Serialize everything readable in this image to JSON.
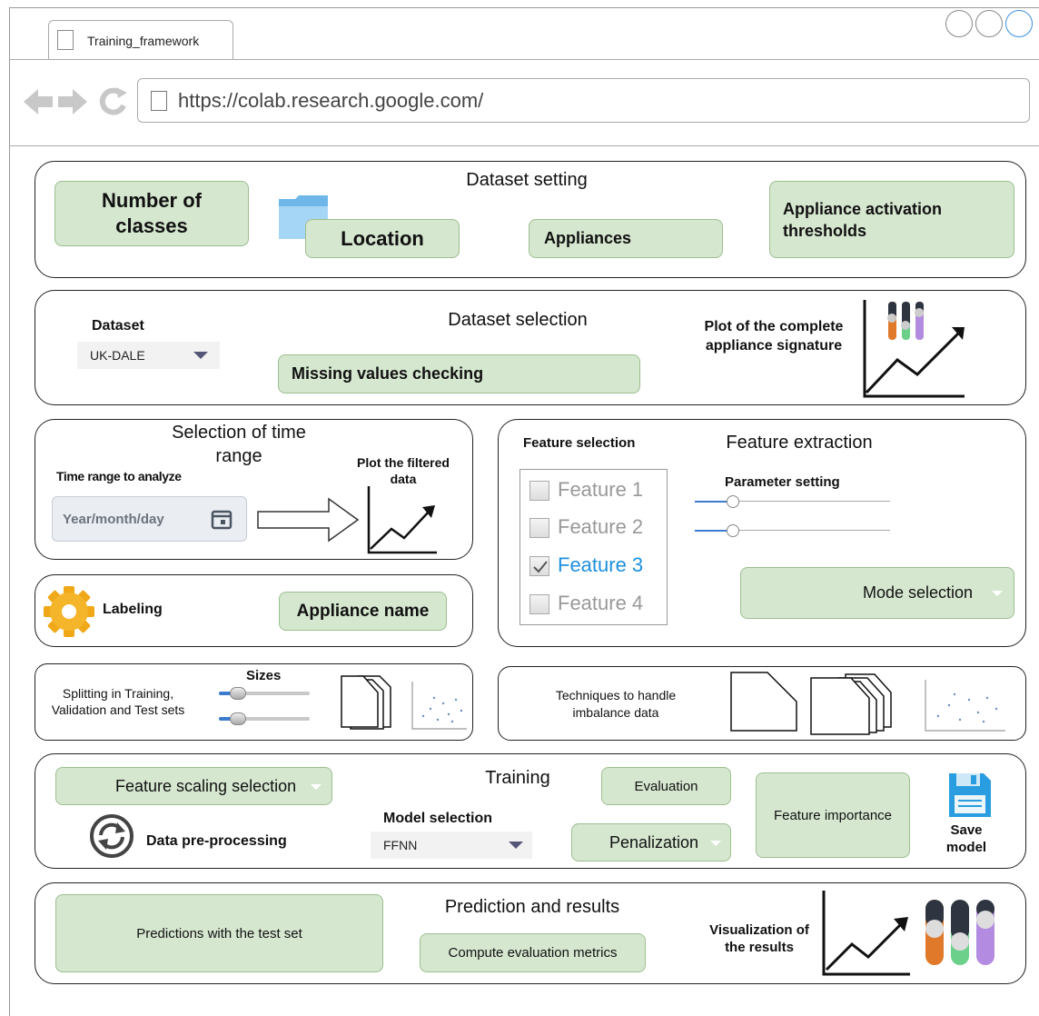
{
  "browser": {
    "tab_title": "Training_framework",
    "url": "https://colab.research.google.com/"
  },
  "dataset_setting": {
    "title": "Dataset setting",
    "number_of_classes": "Number of classes",
    "location": "Location",
    "appliances": "Appliances",
    "thresholds": "Appliance activation thresholds"
  },
  "dataset_selection": {
    "title": "Dataset selection",
    "dataset_label": "Dataset",
    "dataset_value": "UK-DALE",
    "missing_values": "Missing  values checking",
    "plot_label": "Plot of the complete appliance signature"
  },
  "time_range": {
    "title": "Selection  of time range",
    "analyze_label": "Time range to analyze",
    "date_placeholder": "Year/month/day",
    "plot_label": "Plot the filtered data"
  },
  "labeling": {
    "label": "Labeling",
    "appliance_name": "Appliance name"
  },
  "feature_extraction": {
    "title": "Feature extraction",
    "selection_label": "Feature selection",
    "features": [
      {
        "label": "Feature 1",
        "checked": false
      },
      {
        "label": "Feature 2",
        "checked": false
      },
      {
        "label": "Feature 3",
        "checked": true
      },
      {
        "label": "Feature 4",
        "checked": false
      }
    ],
    "parameter_setting": "Parameter setting",
    "mode_selection": "Mode selection"
  },
  "splitting": {
    "label": "Splitting  in Training, Validation  and  Test sets",
    "sizes_label": "Sizes"
  },
  "imbalance": {
    "label": "Techniques  to handle imbalance  data"
  },
  "training": {
    "title": "Training",
    "feature_scaling": "Feature scaling selection",
    "data_preprocessing": "Data pre-processing",
    "model_selection_label": "Model selection",
    "model_value": "FFNN",
    "evaluation": "Evaluation",
    "penalization": "Penalization",
    "feature_importance": "Feature  importance",
    "save_model": "Save model"
  },
  "prediction": {
    "title": "Prediction and results",
    "predictions": "Predictions  with the test set",
    "compute_metrics": "Compute  evaluation  metrics",
    "visualization": "Visualization of the results"
  },
  "colors": {
    "accent_green": "#d6e7d0",
    "check_blue": "#1e90e0",
    "bar_orange": "#e07a2a",
    "bar_green": "#6ccf8a",
    "bar_purple": "#b38be0",
    "bar_dark": "#2e3440"
  }
}
